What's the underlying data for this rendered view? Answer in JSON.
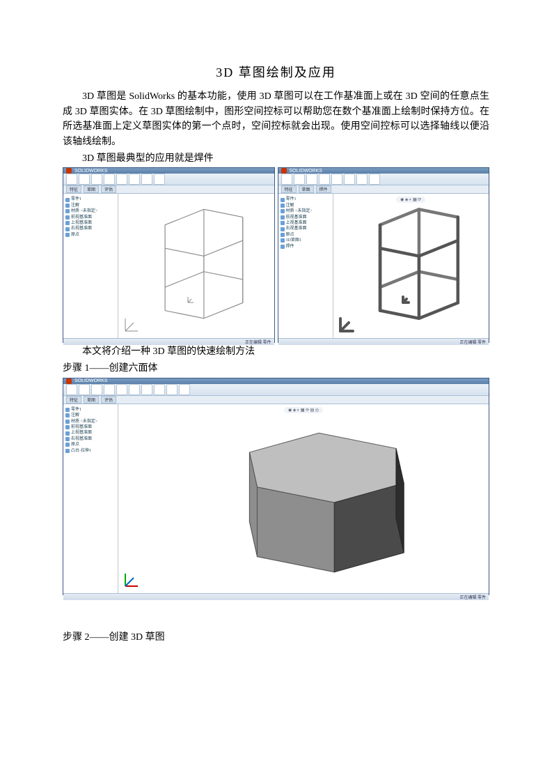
{
  "title": "3D 草图绘制及应用",
  "intro": "3D 草图是 SolidWorks 的基本功能，使用 3D 草图可以在工作基准面上或在 3D 空间的任意点生成 3D 草图实体。在 3D 草图绘制中，图形空间控标可以帮助您在数个基准面上绘制时保持方位。在所选基准面上定义草图实体的第一个点时，空间控标就会出现。使用空间控标可以选择轴线以便沿该轴线绘制。",
  "subtitle": "3D 草图最典型的应用就是焊件",
  "caption": "本文将介绍一种 3D 草图的快速绘制方法",
  "step1": "步骤 1——创建六面体",
  "step2": "步骤 2——创建 3D 草图",
  "sw": {
    "app_name": "SOLIDWORKS",
    "tree_items": [
      "零件1",
      "注解",
      "材质 <未指定>",
      "前视基准面",
      "上视基准面",
      "右视基准面",
      "原点"
    ],
    "tree_items_b": [
      "零件1",
      "注解",
      "材质 <未指定>",
      "前视基准面",
      "上视基准面",
      "右视基准面",
      "原点",
      "3D草图1",
      "焊件"
    ],
    "tree_items_c": [
      "零件1",
      "注解",
      "材质 <未指定>",
      "前视基准面",
      "上视基准面",
      "右视基准面",
      "原点",
      "凸台-拉伸1"
    ],
    "status": "正在编辑 零件"
  }
}
